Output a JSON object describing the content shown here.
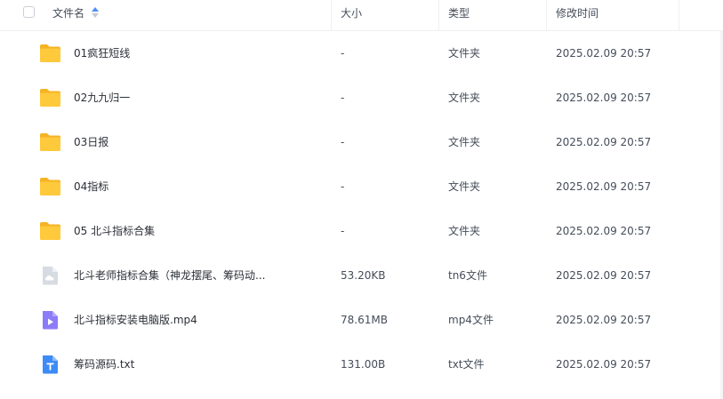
{
  "header": {
    "name_label": "文件名",
    "size_label": "大小",
    "type_label": "类型",
    "mtime_label": "修改时间"
  },
  "files": [
    {
      "name": "01疯狂短线",
      "size": "-",
      "type": "文件夹",
      "mtime": "2025.02.09 20:57",
      "icon": "folder-icon"
    },
    {
      "name": "02九九归一",
      "size": "-",
      "type": "文件夹",
      "mtime": "2025.02.09 20:57",
      "icon": "folder-icon"
    },
    {
      "name": "03日报",
      "size": "-",
      "type": "文件夹",
      "mtime": "2025.02.09 20:57",
      "icon": "folder-icon"
    },
    {
      "name": "04指标",
      "size": "-",
      "type": "文件夹",
      "mtime": "2025.02.09 20:57",
      "icon": "folder-icon"
    },
    {
      "name": "05 北斗指标合集",
      "size": "-",
      "type": "文件夹",
      "mtime": "2025.02.09 20:57",
      "icon": "folder-icon"
    },
    {
      "name": "北斗老师指标合集（神龙摆尾、筹码动...",
      "size": "53.20KB",
      "type": "tn6文件",
      "mtime": "2025.02.09 20:57",
      "icon": "cloud-file-icon"
    },
    {
      "name": "北斗指标安装电脑版.mp4",
      "size": "78.61MB",
      "type": "mp4文件",
      "mtime": "2025.02.09 20:57",
      "icon": "video-file-icon"
    },
    {
      "name": "筹码源码.txt",
      "size": "131.00B",
      "type": "txt文件",
      "mtime": "2025.02.09 20:57",
      "icon": "text-file-icon"
    }
  ],
  "colors": {
    "folder": "#FFC93C",
    "folder_back": "#F5B324",
    "video": "#8C7CF7",
    "text_file": "#3D8BF7",
    "cloud_file": "#D7DBE2",
    "sort_active": "#4F8EF7"
  }
}
